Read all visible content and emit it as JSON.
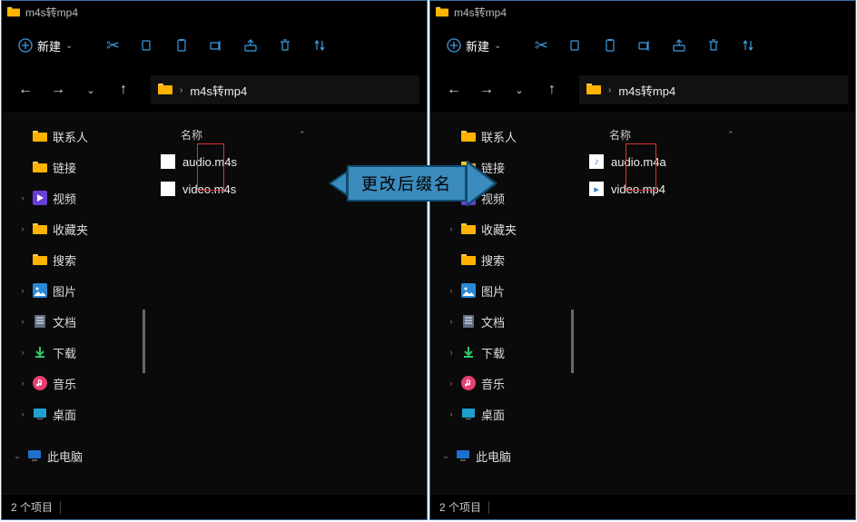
{
  "window_title": "m4s转mp4",
  "new_label": "新建",
  "breadcrumb": "m4s转mp4",
  "col_name": "名称",
  "sidebar": [
    {
      "icon": "folder",
      "label": "联系人",
      "caret": ""
    },
    {
      "icon": "folder",
      "label": "链接",
      "caret": ""
    },
    {
      "icon": "videos",
      "label": "视频",
      "caret": "›"
    },
    {
      "icon": "folder",
      "label": "收藏夹",
      "caret": "›"
    },
    {
      "icon": "folder",
      "label": "搜索",
      "caret": ""
    },
    {
      "icon": "pictures",
      "label": "图片",
      "caret": "›"
    },
    {
      "icon": "documents",
      "label": "文档",
      "caret": "›"
    },
    {
      "icon": "downloads",
      "label": "下载",
      "caret": "›"
    },
    {
      "icon": "music",
      "label": "音乐",
      "caret": "›"
    },
    {
      "icon": "desktop",
      "label": "桌面",
      "caret": "›"
    },
    {
      "icon": "pc",
      "label": "此电脑",
      "caret": "⌄"
    }
  ],
  "left_files": [
    {
      "icon": "file",
      "name": "audio.m4s"
    },
    {
      "icon": "file",
      "name": "video.m4s"
    }
  ],
  "right_files": [
    {
      "icon": "audio",
      "name": "audio.m4a"
    },
    {
      "icon": "video",
      "name": "video.mp4"
    }
  ],
  "status_text": "2 个项目",
  "annotation": "更改后缀名"
}
